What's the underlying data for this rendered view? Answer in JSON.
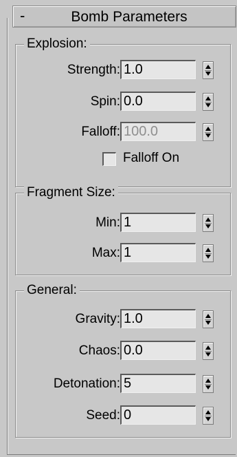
{
  "rollout": {
    "collapse_symbol": "-",
    "title": "Bomb Parameters"
  },
  "explosion": {
    "title": "Explosion:",
    "strength": {
      "label": "Strength:",
      "value": "1.0"
    },
    "spin": {
      "label": "Spin:",
      "value": "0.0"
    },
    "falloff": {
      "label": "Falloff:",
      "value": "100.0",
      "enabled": false
    },
    "falloff_on": {
      "label": "Falloff On",
      "checked": false
    }
  },
  "fragment_size": {
    "title": "Fragment Size:",
    "min": {
      "label": "Min:",
      "value": "1"
    },
    "max": {
      "label": "Max:",
      "value": "1"
    }
  },
  "general": {
    "title": "General:",
    "gravity": {
      "label": "Gravity:",
      "value": "1.0"
    },
    "chaos": {
      "label": "Chaos:",
      "value": "0.0"
    },
    "detonation": {
      "label": "Detonation:",
      "value": "5"
    },
    "seed": {
      "label": "Seed:",
      "value": "0"
    }
  },
  "icons": {
    "spinner": "spinner-arrows-icon"
  }
}
